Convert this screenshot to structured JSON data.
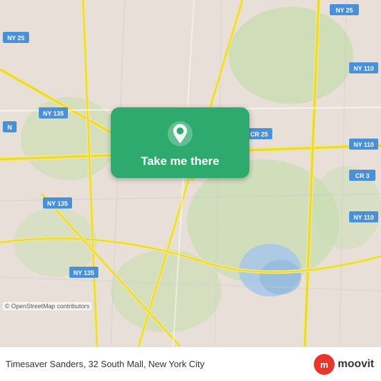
{
  "map": {
    "background_color": "#e8e0d8",
    "osm_credit": "© OpenStreetMap contributors"
  },
  "button": {
    "label": "Take me there",
    "bg_color": "#2eaa6e"
  },
  "bottom_bar": {
    "location_text": "Timesaver Sanders, 32 South Mall, New York City",
    "logo_text": "moovit"
  }
}
